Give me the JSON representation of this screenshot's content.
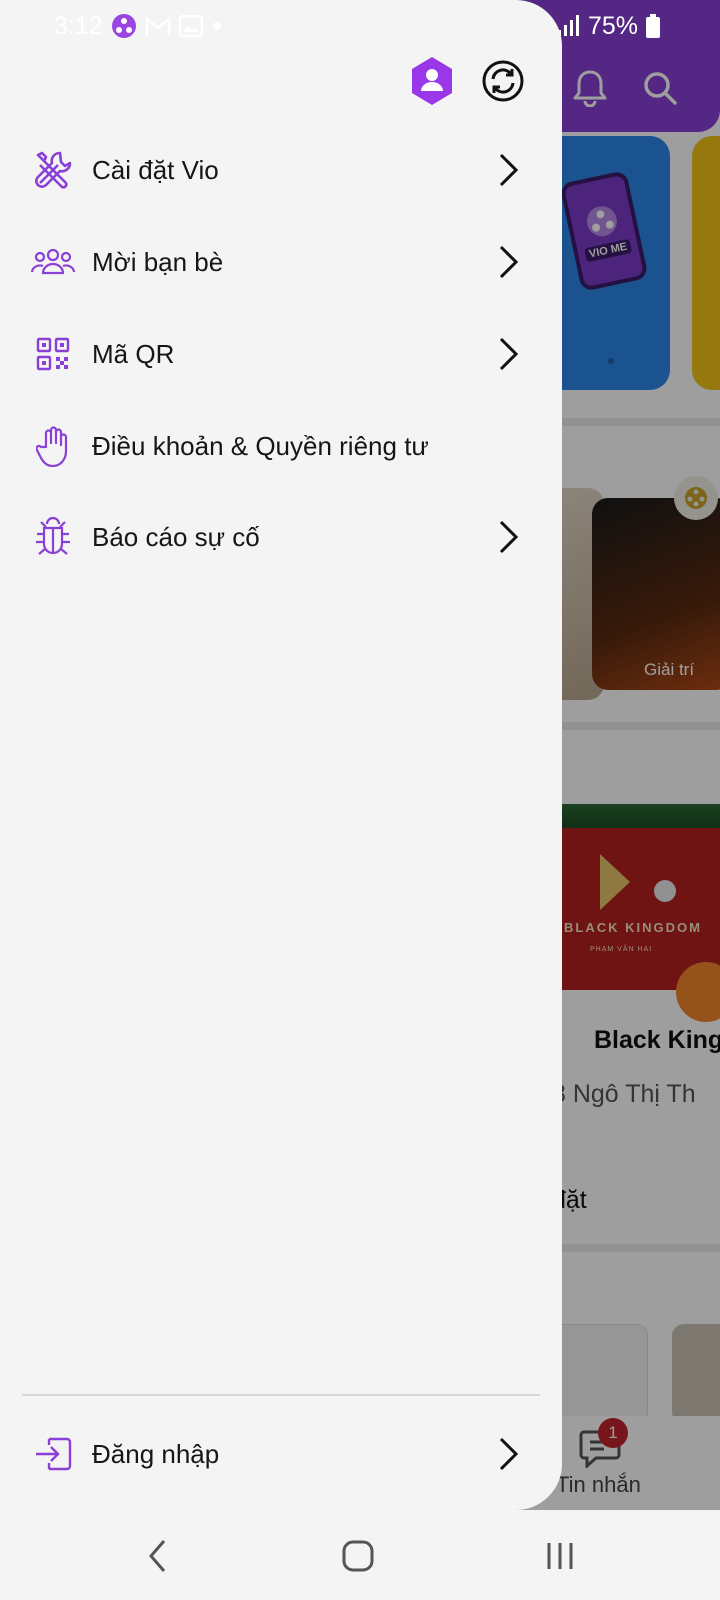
{
  "status_bar": {
    "time": "3:12",
    "battery": "75%"
  },
  "drawer": {
    "menu_items": [
      {
        "label": "Cài đặt Vio",
        "icon": "tools-icon"
      },
      {
        "label": "Mời bạn bè",
        "icon": "people-group-icon"
      },
      {
        "label": "Mã QR",
        "icon": "qr-code-icon"
      },
      {
        "label": "Điều khoản & Quyền riêng tư",
        "icon": "hand-icon"
      },
      {
        "label": "Báo cáo sự cố",
        "icon": "bug-icon"
      }
    ],
    "footer_item": {
      "label": "Đăng nhập",
      "icon": "login-icon"
    }
  },
  "background_app": {
    "banner_tag": "VIO ME",
    "category_label": "Giải trí",
    "event_banner_title": "BLACK KINGDOM",
    "event_banner_subtitle": "PHẠM VĂN HAI",
    "event_name": "Black King",
    "event_address": "8 Ngô Thị Th",
    "section_text": "đặt",
    "message_tab_label": "Tin nhắn",
    "message_badge": "1"
  },
  "colors": {
    "accent": "#8a3fd6",
    "drawer_bg": "#f4f4f4",
    "text": "#161616",
    "badge": "#c0262d"
  }
}
